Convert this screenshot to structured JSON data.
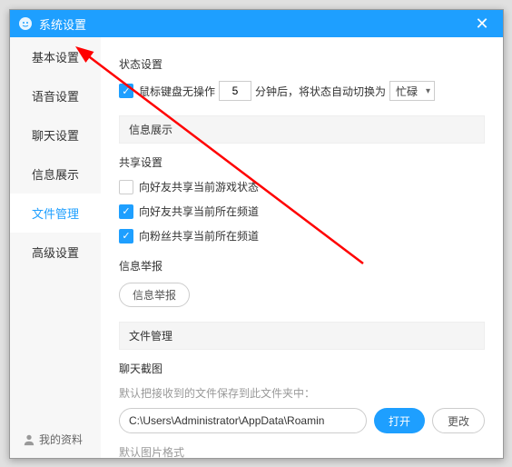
{
  "titlebar": {
    "title": "系统设置",
    "close": "✕"
  },
  "sidebar": {
    "items": [
      "基本设置",
      "语音设置",
      "聊天设置",
      "信息展示",
      "文件管理",
      "高级设置"
    ],
    "activeIndex": 4,
    "profile": "我的资料"
  },
  "status": {
    "title": "状态设置",
    "idle_checked": true,
    "idle_prefix": "鼠标键盘无操作",
    "idle_minutes": "5",
    "idle_mid": "分钟后，将状态自动切换为",
    "idle_select": "忙碌"
  },
  "info_display_header": "信息展示",
  "share": {
    "title": "共享设置",
    "opt1": {
      "checked": false,
      "label": "向好友共享当前游戏状态"
    },
    "opt2": {
      "checked": true,
      "label": "向好友共享当前所在频道"
    },
    "opt3": {
      "checked": true,
      "label": "向粉丝共享当前所在频道"
    }
  },
  "report": {
    "title": "信息举报",
    "btn": "信息举报"
  },
  "filemgr_header": "文件管理",
  "screenshot": {
    "title": "聊天截图",
    "hint": "默认把接收到的文件保存到此文件夹中：",
    "path": "C:\\Users\\Administrator\\AppData\\Roamin",
    "open": "打开",
    "change": "更改"
  },
  "imgfmt": {
    "title": "默认图片格式"
  }
}
